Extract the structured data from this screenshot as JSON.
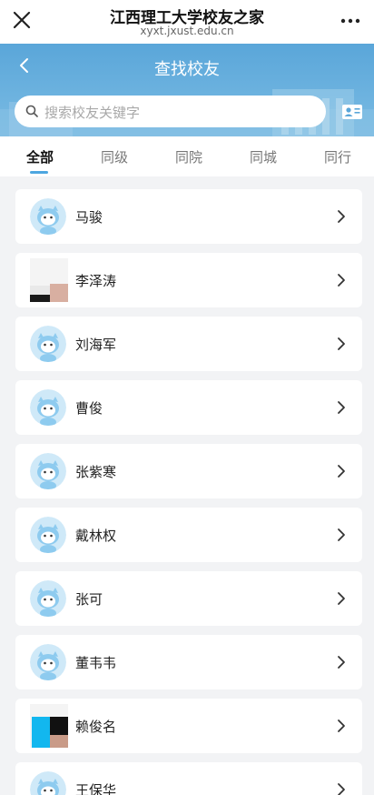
{
  "app": {
    "title": "江西理工大学校友之家",
    "url": "xyxt.jxust.edu.cn"
  },
  "header": {
    "page_title": "查找校友"
  },
  "search": {
    "placeholder": "搜索校友关键字"
  },
  "tabs": [
    {
      "label": "全部",
      "active": true
    },
    {
      "label": "同级",
      "active": false
    },
    {
      "label": "同院",
      "active": false
    },
    {
      "label": "同城",
      "active": false
    },
    {
      "label": "同行",
      "active": false
    }
  ],
  "alumni": [
    {
      "name": "马骏",
      "avatar": "default-avatar-icon"
    },
    {
      "name": "李泽涛",
      "avatar": "photo"
    },
    {
      "name": "刘海军",
      "avatar": "default-avatar-icon"
    },
    {
      "name": "曹俊",
      "avatar": "default-avatar-icon"
    },
    {
      "name": "张紫寒",
      "avatar": "default-avatar-icon"
    },
    {
      "name": "戴林权",
      "avatar": "default-avatar-icon"
    },
    {
      "name": "张可",
      "avatar": "default-avatar-icon"
    },
    {
      "name": "董韦韦",
      "avatar": "default-avatar-icon"
    },
    {
      "name": "赖俊名",
      "avatar": "photo"
    },
    {
      "name": "王保华",
      "avatar": "default-avatar-icon"
    }
  ],
  "colors": {
    "accent": "#4da6e0",
    "banner": "#6cb2df",
    "background": "#f2f3f5"
  }
}
